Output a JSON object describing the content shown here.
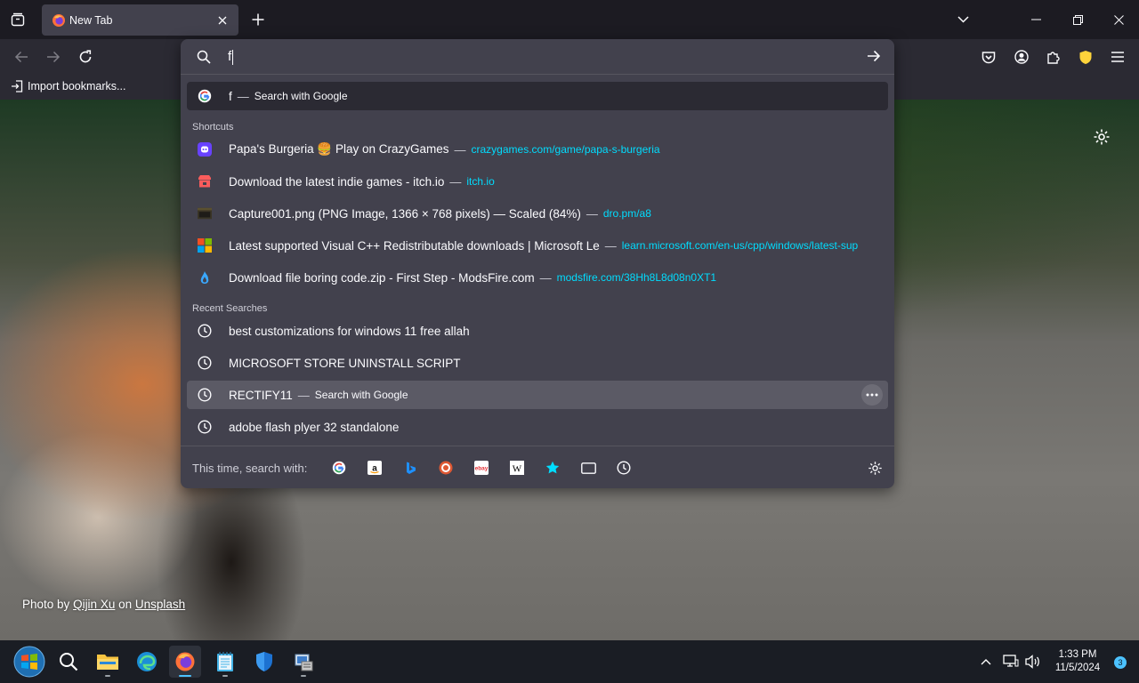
{
  "tab": {
    "title": "New Tab"
  },
  "bookmarks": {
    "import_label": "Import bookmarks..."
  },
  "urlbar": {
    "value": "f"
  },
  "heuristic": {
    "query": "f",
    "sep": "—",
    "action": "Search with Google"
  },
  "shortcuts_label": "Shortcuts",
  "shortcuts": [
    {
      "title": "Papa's Burgeria 🍔 Play on CrazyGames",
      "sep": "—",
      "url": "crazygames.com/game/papa-s-burgeria",
      "icon": "crazygames-icon"
    },
    {
      "title": "Download the latest indie games - itch.io",
      "sep": "—",
      "url": "itch.io",
      "icon": "itchio-icon"
    },
    {
      "title": "Capture001.png (PNG Image, 1366 × 768 pixels) — Scaled (84%)",
      "sep": "—",
      "url": "dro.pm/a8",
      "icon": "image-thumbnail-icon"
    },
    {
      "title": "Latest supported Visual C++ Redistributable downloads | Microsoft Le",
      "sep": "—",
      "url": "learn.microsoft.com/en-us/cpp/windows/latest-sup",
      "icon": "microsoft-icon"
    },
    {
      "title": "Download file boring code.zip - First Step - ModsFire.com",
      "sep": "—",
      "url": "modsfire.com/38Hh8L8d08n0XT1",
      "icon": "modsfire-icon"
    }
  ],
  "recent_label": "Recent Searches",
  "recent": [
    {
      "title": "best customizations for windows 11 free allah"
    },
    {
      "title": "MICROSOFT STORE UNINSTALL SCRIPT"
    },
    {
      "title": "RECTIFY11",
      "sep": "—",
      "action": "Search with Google"
    },
    {
      "title": "adobe flash plyer 32 standalone"
    }
  ],
  "oneoff": {
    "label": "This time, search with:"
  },
  "photo_credit": {
    "prefix": "Photo by",
    "author": "Qijin Xu",
    "mid": "on",
    "site": "Unsplash"
  },
  "clock": {
    "time": "1:33 PM",
    "date": "11/5/2024"
  },
  "notification_count": "3",
  "colors": {
    "panel": "#42414d",
    "url_link": "#00ddff",
    "accent": "#4cc2ff"
  }
}
